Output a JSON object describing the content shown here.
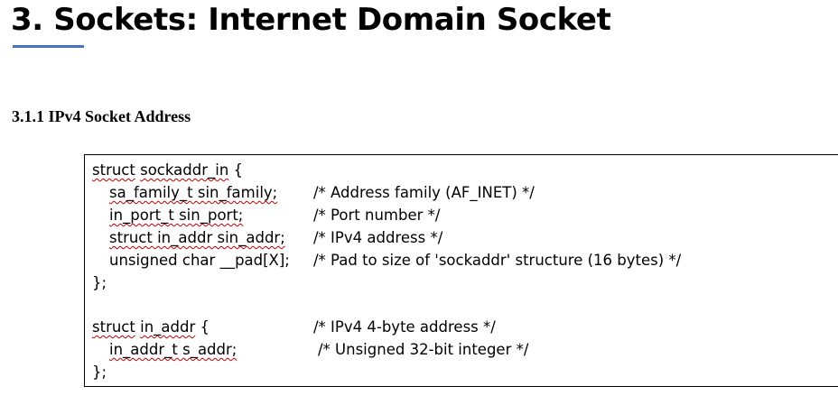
{
  "title": "3. Sockets: Internet Domain Socket",
  "subheading": "3.1.1 IPv4 Socket Address",
  "code": {
    "sockaddr_in": {
      "open_kw": "struct",
      "open_name": "sockaddr_in",
      "open_brace": "{",
      "fields": [
        {
          "decl": "sa_family_t sin_family;",
          "comment": "/* Address family (AF_INET) */"
        },
        {
          "decl": "in_port_t sin_port;",
          "comment": "/* Port number */"
        },
        {
          "decl": "struct in_addr sin_addr;",
          "comment": "/* IPv4 address */"
        },
        {
          "decl": "unsigned char __pad[X];",
          "comment": "/* Pad to size of 'sockaddr' structure (16 bytes) */"
        }
      ],
      "close": "};"
    },
    "in_addr": {
      "open_kw": "struct",
      "open_name": "in_addr",
      "open_brace": "{",
      "open_comment": "/* IPv4 4-byte address */",
      "field_decl": "in_addr_t s_addr;",
      "field_comment": "/* Unsigned 32-bit integer */",
      "close": "};"
    }
  }
}
